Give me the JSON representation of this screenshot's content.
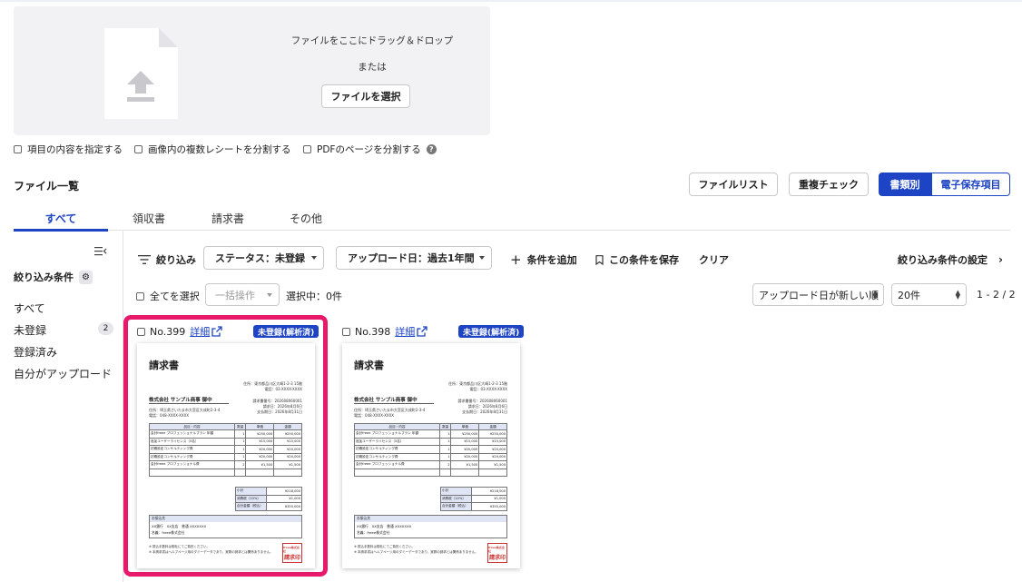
{
  "upload": {
    "drop_text": "ファイルをここにドラッグ＆ドロップ",
    "or_text": "または",
    "select_button": "ファイルを選択"
  },
  "options": [
    {
      "label": "項目の内容を指定する",
      "checked": false
    },
    {
      "label": "画像内の複数レシートを分割する",
      "checked": false
    },
    {
      "label": "PDFのページを分割する",
      "checked": false
    }
  ],
  "file_list": {
    "title": "ファイル一覧",
    "actions": {
      "file_list": "ファイルリスト",
      "duplicate_check": "重複チェック"
    },
    "toggle": {
      "by_type": "書類別",
      "e_storage": "電子保存項目"
    }
  },
  "tabs": [
    {
      "label": "すべて",
      "active": true
    },
    {
      "label": "領収書"
    },
    {
      "label": "請求書"
    },
    {
      "label": "その他"
    }
  ],
  "sidebar": {
    "filter_title": "絞り込み条件",
    "items": [
      {
        "label": "すべて"
      },
      {
        "label": "未登録",
        "count": "2"
      },
      {
        "label": "登録済み"
      },
      {
        "label": "自分がアップロード"
      }
    ]
  },
  "filters": {
    "filter_label": "絞り込み",
    "status": "ステータス：未登録",
    "upload_date": "アップロード日：過去1年間",
    "add_condition": "条件を追加",
    "save_condition": "この条件を保存",
    "clear": "クリア",
    "settings": "絞り込み条件の設定"
  },
  "list_controls": {
    "select_all": "全てを選択",
    "bulk_action": "一括操作",
    "selected": "選択中：0件",
    "sort": "アップロード日が新しい順",
    "per_page": "20件",
    "range": "1 - 2 / 2"
  },
  "cards": [
    {
      "number": "No.399",
      "detail": "詳細",
      "badge": "未登録(解析済)",
      "highlighted": true
    },
    {
      "number": "No.398",
      "detail": "詳細",
      "badge": "未登録(解析済)",
      "highlighted": false
    }
  ],
  "invoice": {
    "title": "請求書",
    "issuer_address": "住所：東京都品川区大崎1-2-3 15階",
    "issuer_tel": "電話：03-XXXX-XXXX",
    "recipient": "株式会社 サンプル商事 御中",
    "recipient_address": "住所：埼玉県さいたま市大宮区大成町2-3-4",
    "recipient_tel": "電話：048-XXXX-XXXX",
    "invoice_no": "請求書番号：202608060001",
    "issue_date": "請求日：2026年8月6日",
    "due_date": "支払期日：2026年8月31日",
    "table_headers": [
      "品目・内容",
      "数量",
      "単価",
      "金額"
    ],
    "rows": [
      [
        "会計freee プロフェッショナルプラン 年額",
        "1",
        "¥250,000",
        "¥250,000"
      ],
      [
        "追加ユーザーライセンス（5名）",
        "1",
        "¥15,000",
        "¥15,000"
      ],
      [
        "初期設定コンサルティング費",
        "1",
        "¥20,000",
        "¥20,000"
      ],
      [
        "初期設定コンサルティング費",
        "1",
        "¥20,000",
        "¥20,000"
      ],
      [
        "会計freee プロフェッショナル費",
        "2",
        "¥1,500",
        "¥1,500"
      ],
      [
        "",
        "",
        "",
        ""
      ]
    ],
    "summary": [
      [
        "小計",
        "¥218,000"
      ],
      [
        "消費税（10%）",
        "¥1,000"
      ],
      [
        "合計金額（税込）",
        "¥355,000"
      ]
    ],
    "bank_title": "お振込先",
    "bank_line1": "XX銀行　XX支店　普通 XXXXXXX",
    "bank_line2": "名義：freee株式会社",
    "note1": "※ 振込手数料は御社にてご負担ください。",
    "note2": "※ 本請求書はヘルプページ用のダミーデータであり、実際の請求とは関係ありません。",
    "stamp_top": "freee株式会社",
    "stamp_main": "請求印"
  }
}
